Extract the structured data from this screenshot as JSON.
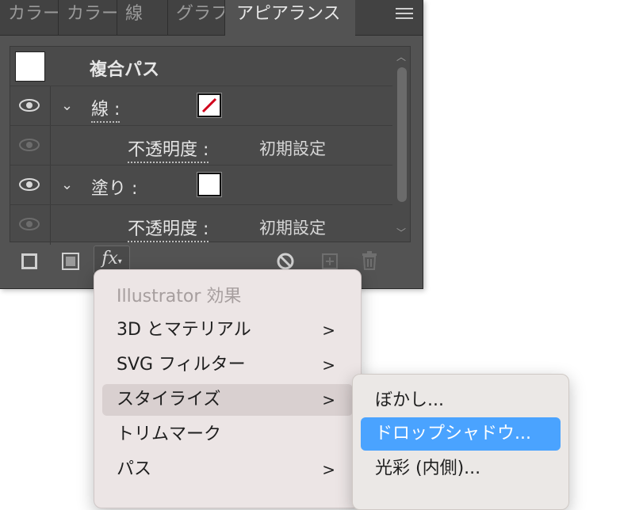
{
  "tabs": [
    {
      "label": "カラー"
    },
    {
      "label": "カラー"
    },
    {
      "label": "線"
    },
    {
      "label": "グラフ"
    },
    {
      "label": "アピアランス"
    }
  ],
  "appearance": {
    "header": "複合パス",
    "stroke_label": "線 :",
    "fill_label": "塗り :",
    "opacity_label": "不透明度 :",
    "opacity_value": "初期設定",
    "stroke_swatch_color": "#d0021b",
    "fill_swatch_color": "#ffffff"
  },
  "context_menu": {
    "header": "Illustrator 効果",
    "items": [
      {
        "label": "3D とマテリアル",
        "submenu": ">"
      },
      {
        "label": "SVG フィルター",
        "submenu": ">"
      },
      {
        "label": "スタイライズ",
        "submenu": ">"
      },
      {
        "label": "トリムマーク",
        "submenu": ""
      },
      {
        "label": "パス",
        "submenu": ">"
      }
    ]
  },
  "submenu": {
    "items": [
      {
        "label": "ぼかし..."
      },
      {
        "label": "ドロップシャドウ..."
      },
      {
        "label": "光彩 (内側)..."
      }
    ]
  },
  "colors": {
    "panel_bg": "#535353",
    "selection": "#4aa3ff"
  }
}
